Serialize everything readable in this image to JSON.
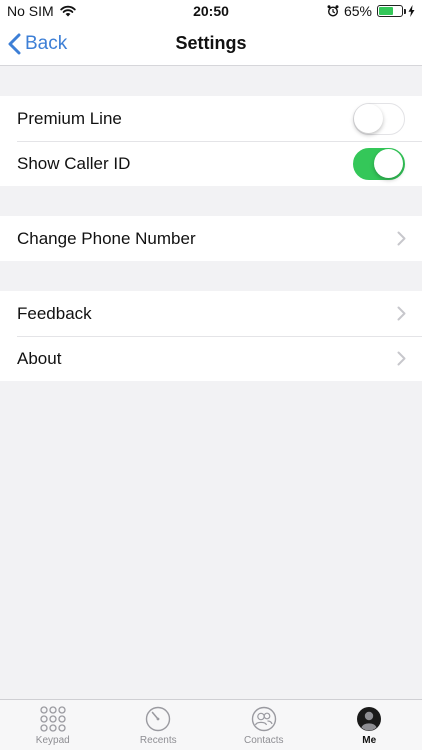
{
  "status_bar": {
    "carrier": "No SIM",
    "time": "20:50",
    "battery_percent": "65%",
    "battery_level": 0.65
  },
  "nav": {
    "back_label": "Back",
    "title": "Settings"
  },
  "groups": [
    {
      "rows": [
        {
          "label": "Premium Line",
          "toggle": false
        },
        {
          "label": "Show Caller ID",
          "toggle": true
        }
      ]
    },
    {
      "rows": [
        {
          "label": "Change Phone Number"
        }
      ]
    },
    {
      "rows": [
        {
          "label": "Feedback"
        },
        {
          "label": "About"
        }
      ]
    }
  ],
  "tabs": [
    {
      "label": "Keypad",
      "icon": "keypad-icon",
      "active": false
    },
    {
      "label": "Recents",
      "icon": "clock-icon",
      "active": false
    },
    {
      "label": "Contacts",
      "icon": "contacts-icon",
      "active": false
    },
    {
      "label": "Me",
      "icon": "person-icon",
      "active": true
    }
  ],
  "colors": {
    "accent": "#3d7fd6",
    "toggle_on": "#34c759",
    "background": "#f2f2f4"
  }
}
